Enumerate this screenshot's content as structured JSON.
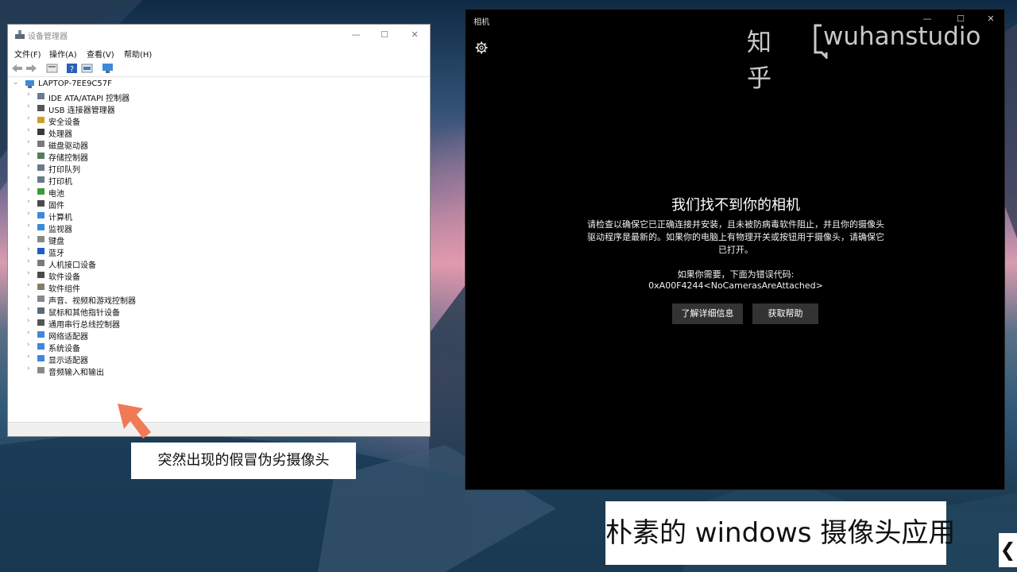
{
  "device_manager": {
    "title": "设备管理器",
    "window_controls": {
      "minimize": "—",
      "maximize": "☐",
      "close": "✕"
    },
    "menu": [
      "文件(F)",
      "操作(A)",
      "查看(V)",
      "帮助(H)"
    ],
    "root": "LAPTOP-7EE9C57F",
    "tree": [
      {
        "label": "IDE ATA/ATAPI 控制器",
        "icon": "ide-controller-icon"
      },
      {
        "label": "USB 连接器管理器",
        "icon": "usb-icon"
      },
      {
        "label": "安全设备",
        "icon": "security-device-icon"
      },
      {
        "label": "处理器",
        "icon": "processor-icon"
      },
      {
        "label": "磁盘驱动器",
        "icon": "disk-drive-icon"
      },
      {
        "label": "存储控制器",
        "icon": "storage-controller-icon"
      },
      {
        "label": "打印队列",
        "icon": "print-queue-icon"
      },
      {
        "label": "打印机",
        "icon": "printer-icon"
      },
      {
        "label": "电池",
        "icon": "battery-icon"
      },
      {
        "label": "固件",
        "icon": "firmware-icon"
      },
      {
        "label": "计算机",
        "icon": "computer-icon"
      },
      {
        "label": "监视器",
        "icon": "monitor-icon"
      },
      {
        "label": "键盘",
        "icon": "keyboard-icon"
      },
      {
        "label": "蓝牙",
        "icon": "bluetooth-icon"
      },
      {
        "label": "人机接口设备",
        "icon": "hid-icon"
      },
      {
        "label": "软件设备",
        "icon": "software-device-icon"
      },
      {
        "label": "软件组件",
        "icon": "software-component-icon"
      },
      {
        "label": "声音、视频和游戏控制器",
        "icon": "speaker-icon"
      },
      {
        "label": "鼠标和其他指针设备",
        "icon": "mouse-icon"
      },
      {
        "label": "通用串行总线控制器",
        "icon": "usb-controller-icon"
      },
      {
        "label": "网络适配器",
        "icon": "network-adapter-icon"
      },
      {
        "label": "系统设备",
        "icon": "system-device-icon"
      },
      {
        "label": "显示适配器",
        "icon": "display-adapter-icon"
      },
      {
        "label": "音频输入和输出",
        "icon": "audio-io-icon"
      }
    ]
  },
  "camera": {
    "title": "相机",
    "window_controls": {
      "minimize": "—",
      "maximize": "☐",
      "close": "✕"
    },
    "error_title": "我们找不到你的相机",
    "error_description": "请检查以确保它已正确连接并安装，且未被防病毒软件阻止，并且你的摄像头驱动程序是最新的。如果你的电脑上有物理开关或按钮用于摄像头，请确保它已打开。",
    "code_lead": "如果你需要，下面为错误代码:",
    "code": "0xA00F4244<NoCamerasAreAttached>",
    "buttons": {
      "learn_more": "了解详细信息",
      "get_help": "获取帮助"
    }
  },
  "watermark": {
    "site": "知乎",
    "author": "wuhanstudio"
  },
  "captions": {
    "fake_camera": "突然出现的假冒伪劣摄像头",
    "camera_app": "朴素的 windows 摄像头应用"
  },
  "side_chevron": "❮",
  "colors": {
    "camera_bg": "#000000",
    "camera_button": "#333333",
    "pointer_arrow": "#f07a55"
  }
}
